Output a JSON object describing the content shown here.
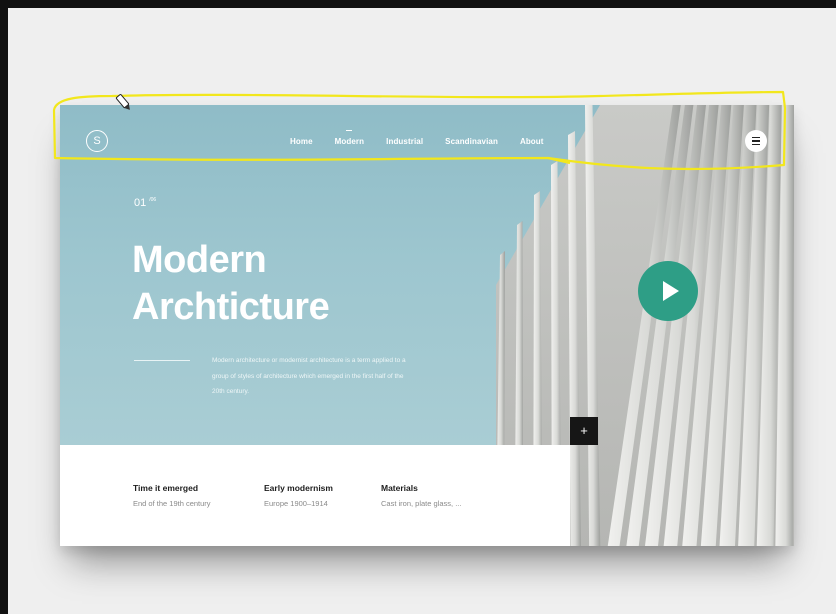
{
  "logo": {
    "letter": "S"
  },
  "nav": {
    "items": [
      {
        "label": "Home"
      },
      {
        "label": "Modern"
      },
      {
        "label": "Industrial"
      },
      {
        "label": "Scandinavian"
      },
      {
        "label": "About"
      }
    ],
    "active": "Modern"
  },
  "hero": {
    "slide_number": "01",
    "slide_sup": "/06",
    "title_line1": "Modern",
    "title_line2": "Archticture",
    "description": "Modern architecture or modernist architecture is a term applied to a group of styles of architecture which emerged in the first half of the 20th century."
  },
  "buttons": {
    "plus": "+"
  },
  "info": {
    "columns": [
      {
        "title": "Time it emerged",
        "value": "End of the 19th century"
      },
      {
        "title": "Early modernism",
        "value": "Europe 1900–1914"
      },
      {
        "title": "Materials",
        "value": "Cast iron, plate glass, ..."
      }
    ]
  },
  "colors": {
    "sky": "#9dc6cf",
    "play_button": "#2e9e86",
    "annotation": "#f2e71c",
    "plus_button": "#161616"
  },
  "icons": [
    "logo-circle-icon",
    "menu-icon",
    "play-icon",
    "plus-icon",
    "cursor-icon"
  ]
}
